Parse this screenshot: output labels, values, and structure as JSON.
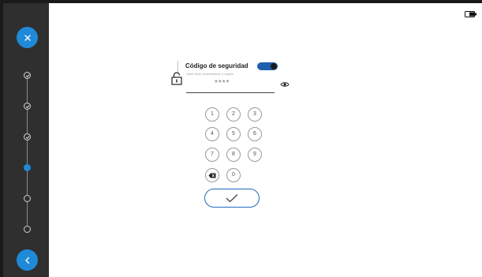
{
  "sidebar": {
    "close_icon": "close-icon",
    "back_icon": "chevron-left-icon",
    "steps": [
      {
        "status": "done"
      },
      {
        "status": "done"
      },
      {
        "status": "done"
      },
      {
        "status": "current"
      },
      {
        "status": "pending"
      },
      {
        "status": "pending"
      }
    ]
  },
  "status_bar": {
    "battery_icon": "battery-icon"
  },
  "form": {
    "title": "Código de seguridad",
    "toggle_on": true,
    "hint": "Debe tener exactamente 4 dígitos",
    "password_value": "****",
    "lock_icon": "lock-icon",
    "eye_icon": "eye-icon"
  },
  "keypad": {
    "keys": [
      "1",
      "2",
      "3",
      "4",
      "5",
      "6",
      "7",
      "8",
      "9"
    ],
    "zero": "0",
    "backspace_icon": "backspace-icon"
  },
  "confirm": {
    "icon": "check-icon"
  },
  "colors": {
    "accent": "#1f8ad8",
    "sidebar": "#2f2f2f",
    "toggle": "#1f5fae"
  }
}
